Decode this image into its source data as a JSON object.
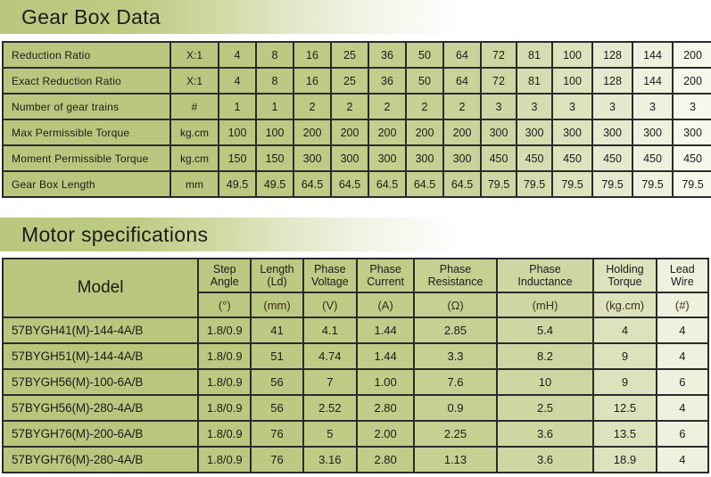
{
  "sections": {
    "gearbox": {
      "banner_title": "Gear Box Data",
      "rows": [
        {
          "label": "Reduction Ratio",
          "unit": "X:1",
          "values": [
            "4",
            "8",
            "16",
            "25",
            "36",
            "50",
            "64",
            "72",
            "81",
            "100",
            "128",
            "144",
            "200"
          ]
        },
        {
          "label": "Exact Reduction Ratio",
          "unit": "X:1",
          "values": [
            "4",
            "8",
            "16",
            "25",
            "36",
            "50",
            "64",
            "72",
            "81",
            "100",
            "128",
            "144",
            "200"
          ]
        },
        {
          "label": "Number of gear trains",
          "unit": "#",
          "values": [
            "1",
            "1",
            "2",
            "2",
            "2",
            "2",
            "2",
            "3",
            "3",
            "3",
            "3",
            "3",
            "3"
          ]
        },
        {
          "label": "Max Permissible Torque",
          "unit": "kg.cm",
          "values": [
            "100",
            "100",
            "200",
            "200",
            "200",
            "200",
            "200",
            "300",
            "300",
            "300",
            "300",
            "300",
            "300"
          ]
        },
        {
          "label": "Moment Permissible Torque",
          "unit": "kg.cm",
          "values": [
            "150",
            "150",
            "300",
            "300",
            "300",
            "300",
            "300",
            "450",
            "450",
            "450",
            "450",
            "450",
            "450"
          ]
        },
        {
          "label": "Gear Box Length",
          "unit": "mm",
          "values": [
            "49.5",
            "49.5",
            "64.5",
            "64.5",
            "64.5",
            "64.5",
            "64.5",
            "79.5",
            "79.5",
            "79.5",
            "79.5",
            "79.5",
            "79.5"
          ]
        }
      ]
    },
    "motor": {
      "banner_title": "Motor specifications",
      "headers": [
        {
          "label": "Model",
          "unit": ""
        },
        {
          "label": "Step\nAngle",
          "line1": "Step",
          "line2": "Angle",
          "unit": "(°)"
        },
        {
          "label": "Length\n(Ld)",
          "line1": "Length",
          "line2": "(Ld)",
          "unit": "(mm)"
        },
        {
          "label": "Phase\nVoltage",
          "line1": "Phase",
          "line2": "Voltage",
          "unit": "(V)"
        },
        {
          "label": "Phase\nCurrent",
          "line1": "Phase",
          "line2": "Current",
          "unit": "(A)"
        },
        {
          "label": "Phase\nResistance",
          "line1": "Phase",
          "line2": "Resistance",
          "unit": "(Ω)"
        },
        {
          "label": "Phase\nInductance",
          "line1": "Phase",
          "line2": "Inductance",
          "unit": "(mH)"
        },
        {
          "label": "Holding\nTorque",
          "line1": "Holding",
          "line2": "Torque",
          "unit": "(kg.cm)"
        },
        {
          "label": "Lead\nWire",
          "line1": "Lead",
          "line2": "Wire",
          "unit": "(#)"
        }
      ],
      "rows": [
        [
          "57BYGH41(M)-144-4A/B",
          "1.8/0.9",
          "41",
          "4.1",
          "1.44",
          "2.85",
          "5.4",
          "4",
          "4"
        ],
        [
          "57BYGH51(M)-144-4A/B",
          "1.8/0.9",
          "51",
          "4.74",
          "1.44",
          "3.3",
          "8.2",
          "9",
          "4"
        ],
        [
          "57BYGH56(M)-100-6A/B",
          "1.8/0.9",
          "56",
          "7",
          "1.00",
          "7.6",
          "10",
          "9",
          "6"
        ],
        [
          "57BYGH56(M)-280-4A/B",
          "1.8/0.9",
          "56",
          "2.52",
          "2.80",
          "0.9",
          "2.5",
          "12.5",
          "4"
        ],
        [
          "57BYGH76(M)-200-6A/B",
          "1.8/0.9",
          "76",
          "5",
          "2.00",
          "2.25",
          "3.6",
          "13.5",
          "6"
        ],
        [
          "57BYGH76(M)-280-4A/B",
          "1.8/0.9",
          "76",
          "3.16",
          "2.80",
          "1.13",
          "3.6",
          "18.9",
          "4"
        ]
      ]
    }
  },
  "colors": {
    "table_green": "#b9c77e",
    "border": "#2b2b2b",
    "unit_text": "#3a2d18",
    "text": "#1b1b1b"
  }
}
